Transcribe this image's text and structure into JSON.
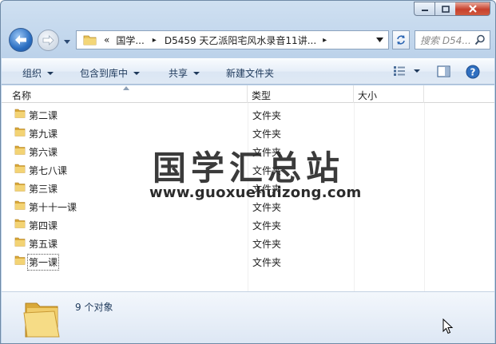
{
  "address": {
    "overflow_glyph": "«",
    "crumbs": [
      "国学...",
      "D5459 天乙派阳宅风水录音11讲..."
    ],
    "separator": "▸"
  },
  "search": {
    "placeholder": "搜索 D54..."
  },
  "toolbar": {
    "organize": "组织",
    "include_in_library": "包含到库中",
    "share": "共享",
    "new_folder": "新建文件夹"
  },
  "columns": {
    "name": "名称",
    "type": "类型",
    "size": "大小"
  },
  "items": [
    {
      "name": "第二课",
      "type": "文件夹"
    },
    {
      "name": "第九课",
      "type": "文件夹"
    },
    {
      "name": "第六课",
      "type": "文件夹"
    },
    {
      "name": "第七八课",
      "type": "文件夹"
    },
    {
      "name": "第三课",
      "type": "文件夹"
    },
    {
      "name": "第十十一课",
      "type": "文件夹"
    },
    {
      "name": "第四课",
      "type": "文件夹"
    },
    {
      "name": "第五课",
      "type": "文件夹"
    },
    {
      "name": "第一课",
      "type": "文件夹"
    }
  ],
  "status": {
    "count_text": "9 个对象"
  },
  "watermark": {
    "cn": "国学汇总站",
    "url": "www.guoxuehuizong.com"
  },
  "icons": {
    "back": "back-arrow-icon",
    "forward": "forward-arrow-icon",
    "folder": "folder-icon",
    "refresh": "refresh-icon",
    "search": "magnifier-icon",
    "view": "view-options-icon",
    "preview": "preview-pane-icon",
    "help": "help-icon"
  },
  "colors": {
    "accent": "#1e395b",
    "frame": "#bcd2ea",
    "folder": "#e8c25a"
  }
}
